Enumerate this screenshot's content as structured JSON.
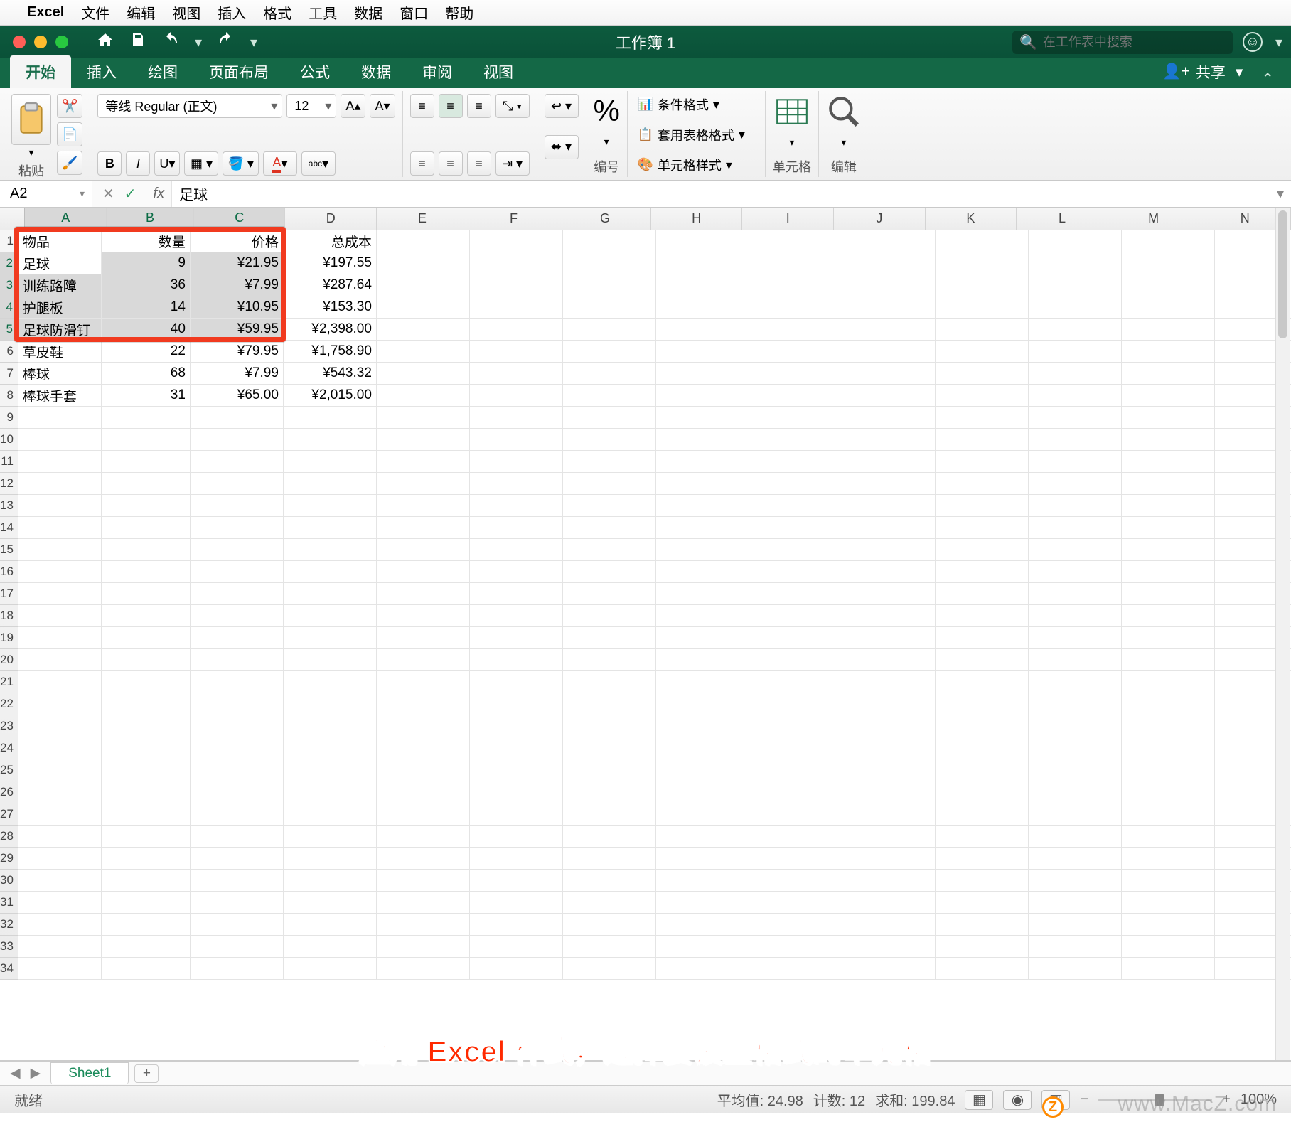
{
  "mac_menu": [
    "Excel",
    "文件",
    "编辑",
    "视图",
    "插入",
    "格式",
    "工具",
    "数据",
    "窗口",
    "帮助"
  ],
  "window_title": "工作簿 1",
  "search_placeholder": "在工作表中搜索",
  "ribbon_tabs": [
    "开始",
    "插入",
    "绘图",
    "页面布局",
    "公式",
    "数据",
    "审阅",
    "视图"
  ],
  "share_label": "共享",
  "ribbon": {
    "paste": "粘贴",
    "font_name": "等线 Regular (正文)",
    "font_size": "12",
    "group_number": "编号",
    "cond_fmt": "条件格式",
    "table_fmt": "套用表格格式",
    "cell_fmt": "单元格样式",
    "group_cells": "单元格",
    "group_edit": "编辑"
  },
  "name_box": "A2",
  "formula_value": "足球",
  "columns": [
    "A",
    "B",
    "C",
    "D",
    "E",
    "F",
    "G",
    "H",
    "I",
    "J",
    "K",
    "L",
    "M",
    "N"
  ],
  "data_rows": [
    {
      "a": "物品",
      "b": "数量",
      "c": "价格",
      "d": "总成本"
    },
    {
      "a": "足球",
      "b": "9",
      "c": "¥21.95",
      "d": "¥197.55"
    },
    {
      "a": "训练路障",
      "b": "36",
      "c": "¥7.99",
      "d": "¥287.64"
    },
    {
      "a": "护腿板",
      "b": "14",
      "c": "¥10.95",
      "d": "¥153.30"
    },
    {
      "a": "足球防滑钉",
      "b": "40",
      "c": "¥59.95",
      "d": "¥2,398.00"
    },
    {
      "a": "草皮鞋",
      "b": "22",
      "c": "¥79.95",
      "d": "¥1,758.90"
    },
    {
      "a": "棒球",
      "b": "68",
      "c": "¥7.99",
      "d": "¥543.32"
    },
    {
      "a": "棒球手套",
      "b": "31",
      "c": "¥65.00",
      "d": "¥2,015.00"
    }
  ],
  "total_rows": 34,
  "sheet_name": "Sheet1",
  "status": {
    "ready": "就绪",
    "avg_label": "平均值:",
    "avg": "24.98",
    "count_label": "计数:",
    "count": "12",
    "sum_label": "求和:",
    "sum": "199.84",
    "zoom": "100%"
  },
  "caption": "应用 Excel 样式，选择要设置格式的单元格",
  "watermark": "www.MacZ.com"
}
